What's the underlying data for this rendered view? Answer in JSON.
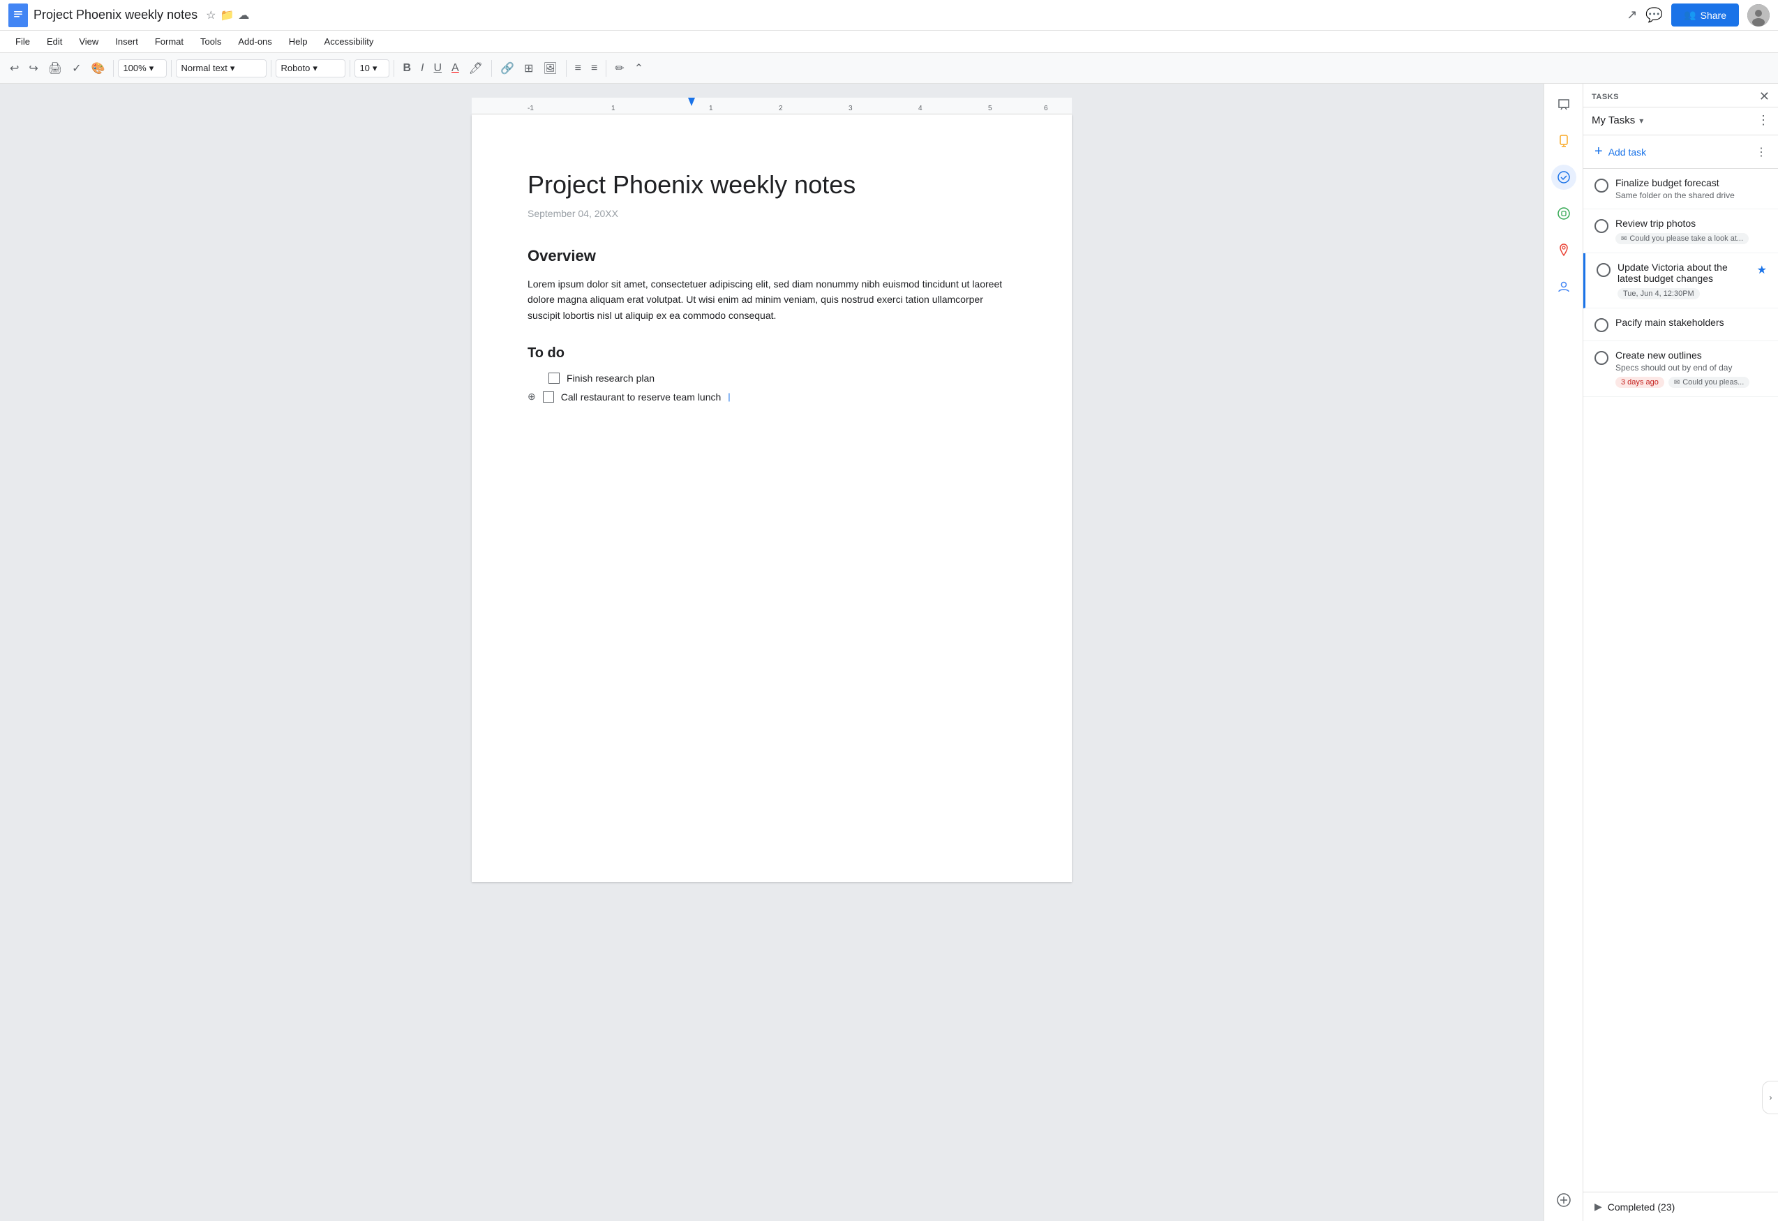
{
  "topbar": {
    "doc_title": "Project Phoenix weekly notes",
    "share_label": "Share",
    "share_icon": "📋"
  },
  "menubar": {
    "items": [
      "File",
      "Edit",
      "View",
      "Insert",
      "Format",
      "Tools",
      "Add-ons",
      "Help",
      "Accessibility"
    ]
  },
  "toolbar": {
    "zoom": "100%",
    "style": "Normal text",
    "font": "Roboto",
    "size": "10",
    "undo_label": "↩",
    "redo_label": "↪"
  },
  "document": {
    "title": "Project Phoenix weekly notes",
    "date": "September 04, 20XX",
    "overview_heading": "Overview",
    "overview_body": "Lorem ipsum dolor sit amet, consectetuer adipiscing elit, sed diam nonummy nibh euismod tincidunt ut laoreet dolore magna aliquam erat volutpat. Ut wisi enim ad minim veniam, quis nostrud exerci tation ullamcorper suscipit lobortis nisl ut aliquip ex ea commodo consequat.",
    "todo_heading": "To do",
    "todo_items": [
      {
        "text": "Finish research plan"
      },
      {
        "text": "Call restaurant to reserve team lunch"
      }
    ]
  },
  "tasks_panel": {
    "section_label": "TASKS",
    "title": "My Tasks",
    "add_task_label": "Add task",
    "tasks": [
      {
        "title": "Finalize budget forecast",
        "subtitle": "Same folder on the shared drive",
        "date": null,
        "email": null,
        "starred": false,
        "days_ago": null
      },
      {
        "title": "Review trip photos",
        "subtitle": null,
        "date": null,
        "email": "Could you please take a look at...",
        "starred": false,
        "days_ago": null
      },
      {
        "title": "Update Victoria about the latest budget changes",
        "subtitle": null,
        "date": "Tue, Jun 4, 12:30PM",
        "email": null,
        "starred": true,
        "days_ago": null
      },
      {
        "title": "Pacify main stakeholders",
        "subtitle": null,
        "date": null,
        "email": null,
        "starred": false,
        "days_ago": null
      },
      {
        "title": "Create new outlines",
        "subtitle": "Specs should out by end of day",
        "date": null,
        "email": "Could you pleas...",
        "starred": false,
        "days_ago": "3 days ago"
      }
    ],
    "completed_label": "Completed (23)"
  }
}
